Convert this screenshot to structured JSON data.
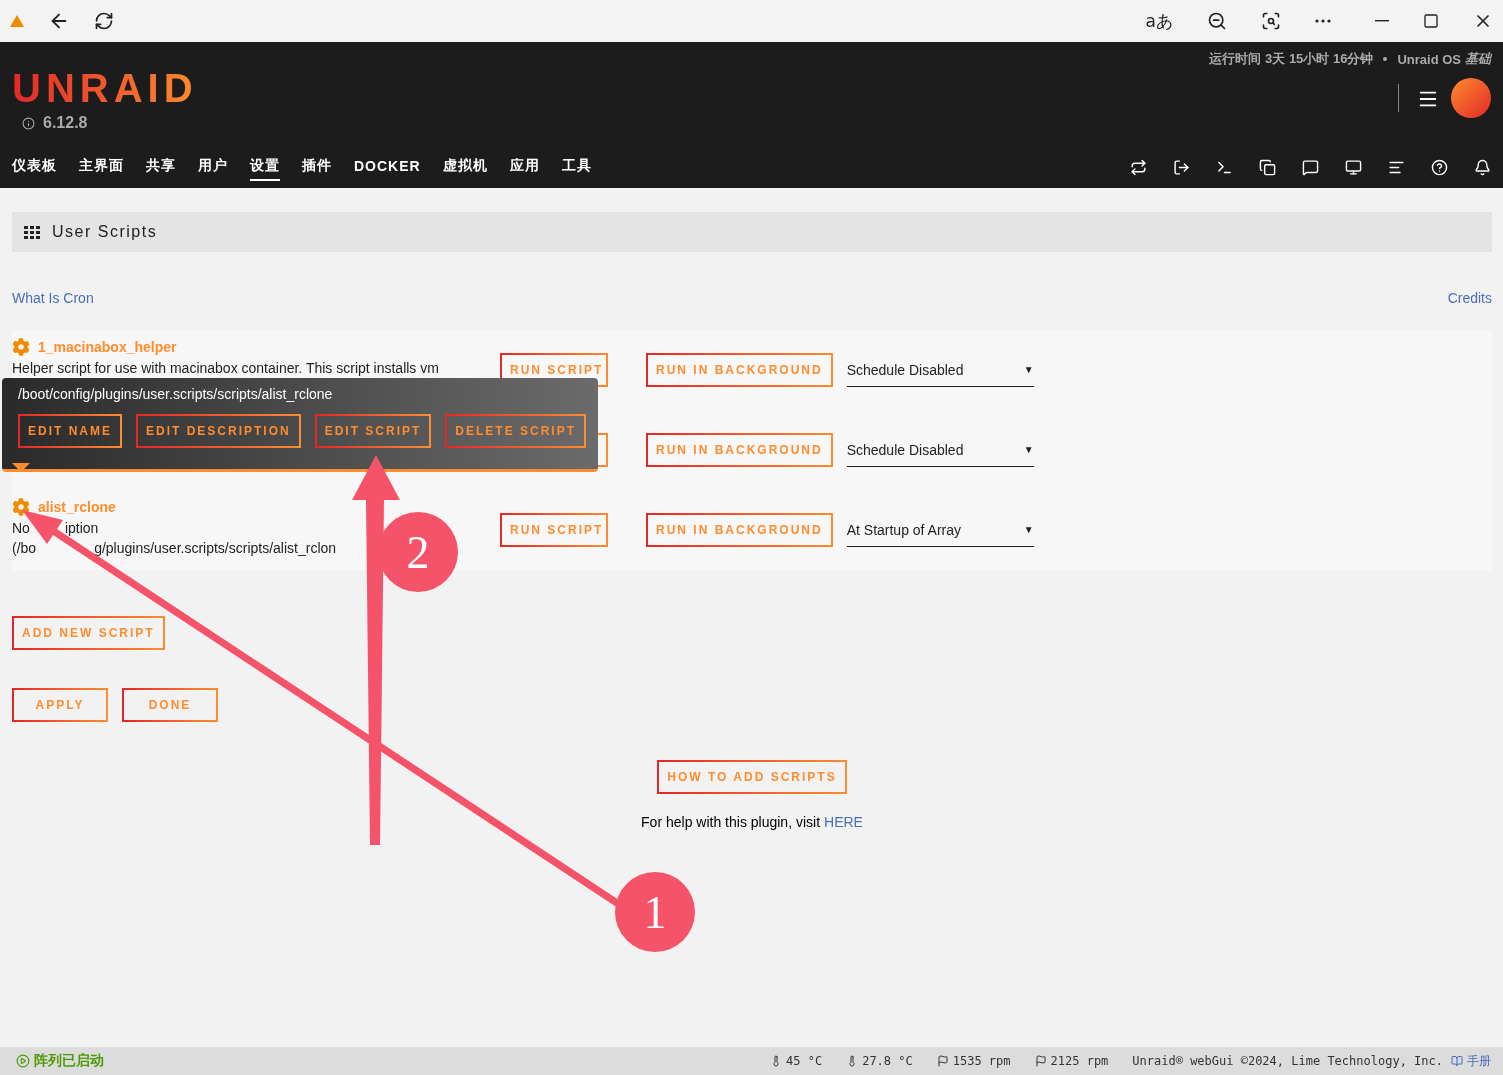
{
  "browser": {
    "buttons": [
      "aあ"
    ]
  },
  "header": {
    "logo": "UNRAID",
    "version": "6.12.8",
    "uptime": "运行时间 3天 15小时 16分钟",
    "os_label": "Unraid OS",
    "os_edition": "基础",
    "nav": [
      {
        "label": "仪表板",
        "selected": false
      },
      {
        "label": "主界面",
        "selected": false
      },
      {
        "label": "共享",
        "selected": false
      },
      {
        "label": "用户",
        "selected": false
      },
      {
        "label": "设置",
        "selected": true
      },
      {
        "label": "插件",
        "selected": false
      },
      {
        "label": "DOCKER",
        "selected": false
      },
      {
        "label": "虚拟机",
        "selected": false
      },
      {
        "label": "应用",
        "selected": false
      },
      {
        "label": "工具",
        "selected": false
      }
    ]
  },
  "page": {
    "title": "User Scripts",
    "left_link": "What Is Cron",
    "right_link": "Credits",
    "scripts": [
      {
        "name": "1_macinabox_helper",
        "description": [
          [
            "Helper script for use with macinabox container. This script installs vm"
          ]
        ],
        "run": "RUN SCRIPT",
        "background": "RUN IN BACKGROUND",
        "schedule": "Schedule Disabled",
        "caret": "▼"
      },
      {
        "background": "RUN IN BACKGROUND",
        "schedule": "Schedule Disabled",
        "caret": "▼"
      },
      {
        "name": "alist_rclone",
        "description": [
          [
            "No",
            "iption"
          ],
          [
            "(/bo",
            "g/plugins/user.scripts/scripts/alist_rclon"
          ]
        ],
        "run": "RUN SCRIPT",
        "background": "RUN IN BACKGROUND",
        "schedule": "At Startup of Array",
        "caret": "▼"
      }
    ],
    "add_button": "ADD NEW SCRIPT",
    "actions": [
      "APPLY",
      "DONE"
    ],
    "how_button": "HOW TO ADD SCRIPTS",
    "help_text": "For help with this plugin, visit",
    "help_link": "HERE",
    "popover": {
      "path": "/boot/config/plugins/user.scripts/scripts/alist_rclone",
      "buttons": [
        "EDIT NAME",
        "EDIT DESCRIPTION",
        "EDIT SCRIPT",
        "DELETE SCRIPT"
      ]
    }
  },
  "annotations": [
    {
      "label": "1"
    },
    {
      "label": "2"
    }
  ],
  "status_bar": {
    "array": "阵列已启动",
    "temps": [
      "45 °C",
      "27.8 °C"
    ],
    "fans": [
      "1535 rpm",
      "2125 rpm"
    ],
    "copyright": "Unraid® webGui ©2024, Lime Technology, Inc.",
    "manual": "手册"
  }
}
